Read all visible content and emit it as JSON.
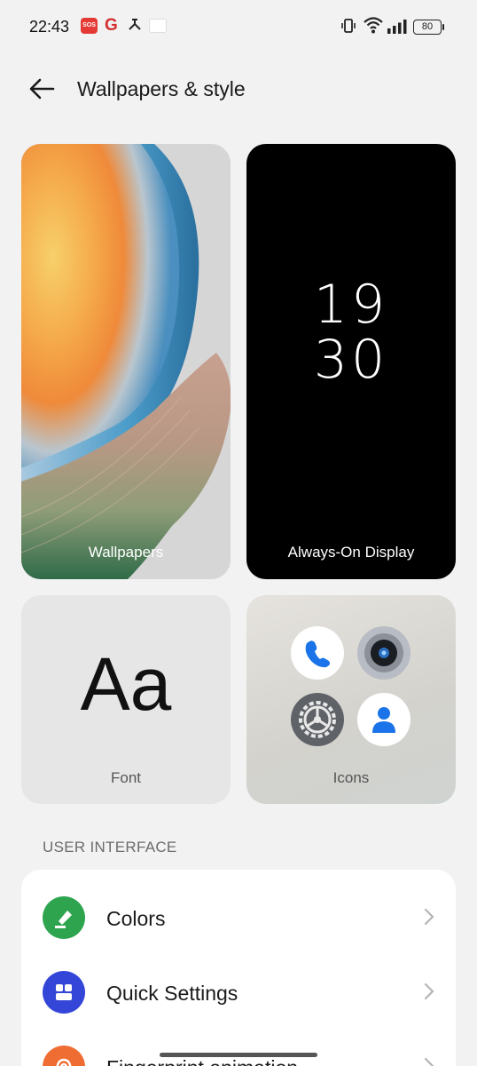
{
  "status_bar": {
    "time": "22:43",
    "sos_label": "SOS",
    "g_label": "G",
    "battery": "80"
  },
  "header": {
    "title": "Wallpapers & style"
  },
  "tiles": {
    "wallpapers": {
      "label": "Wallpapers"
    },
    "aod": {
      "label": "Always-On Display",
      "hours": "19",
      "minutes": "30"
    },
    "font": {
      "label": "Font",
      "sample": "Aa"
    },
    "icons": {
      "label": "Icons"
    }
  },
  "user_interface": {
    "section_title": "USER INTERFACE",
    "items": [
      {
        "label": "Colors",
        "icon": "paint-bucket-icon",
        "color": "#2ea44f"
      },
      {
        "label": "Quick Settings",
        "icon": "quick-settings-icon",
        "color": "#3346d8"
      },
      {
        "label": "Fingerprint animation",
        "icon": "fingerprint-icon",
        "color": "#ef6c33"
      }
    ]
  }
}
